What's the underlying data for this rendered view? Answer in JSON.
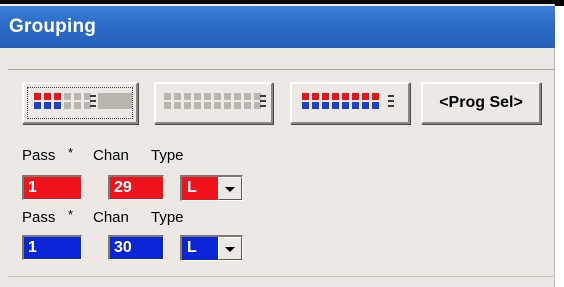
{
  "window": {
    "title": "Grouping"
  },
  "toolbar": {
    "prog_sel_label": "<Prog Sel>",
    "group_buttons": [
      {
        "icon": "group-pattern-red-blue-icon"
      },
      {
        "icon": "group-pattern-grey-icon"
      },
      {
        "icon": "group-pattern-red-blue-wide-icon"
      }
    ]
  },
  "rows": [
    {
      "headers": {
        "pass": "Pass",
        "star": "*",
        "chan": "Chan",
        "type": "Type"
      },
      "pass_value": "1",
      "chan_value": "29",
      "type_value": "L",
      "color": "red"
    },
    {
      "headers": {
        "pass": "Pass",
        "star": "*",
        "chan": "Chan",
        "type": "Type"
      },
      "pass_value": "1",
      "chan_value": "30",
      "type_value": "L",
      "color": "blue"
    }
  ],
  "colors": {
    "title_bar": "#2b6cc8",
    "red": "#f0131c",
    "blue": "#0a25d8",
    "panel": "#ece9e4"
  }
}
